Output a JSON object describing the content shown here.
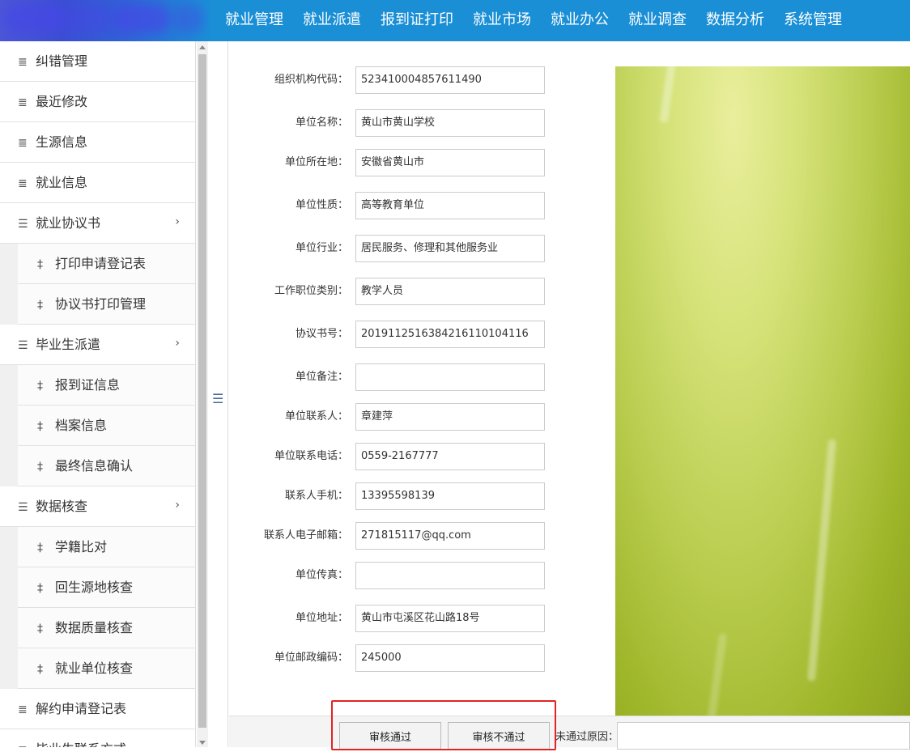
{
  "nav": {
    "items": [
      "就业管理",
      "就业派遣",
      "报到证打印",
      "就业市场",
      "就业办公",
      "就业调查",
      "数据分析",
      "系统管理"
    ]
  },
  "sidebar": {
    "items": [
      {
        "label": "纠错管理",
        "level": "top",
        "icon": "indent-icon"
      },
      {
        "label": "最近修改",
        "level": "top",
        "icon": "indent-icon"
      },
      {
        "label": "生源信息",
        "level": "top",
        "icon": "indent-icon"
      },
      {
        "label": "就业信息",
        "level": "top",
        "icon": "indent-icon"
      },
      {
        "label": "就业协议书",
        "level": "top",
        "icon": "list-icon",
        "expandable": true
      },
      {
        "label": "打印申请登记表",
        "level": "sub",
        "icon": "sign-icon"
      },
      {
        "label": "协议书打印管理",
        "level": "sub",
        "icon": "sign-icon"
      },
      {
        "label": "毕业生派遣",
        "level": "top",
        "icon": "list-icon",
        "expandable": true
      },
      {
        "label": "报到证信息",
        "level": "sub",
        "icon": "sign-icon"
      },
      {
        "label": "档案信息",
        "level": "sub",
        "icon": "sign-icon"
      },
      {
        "label": "最终信息确认",
        "level": "sub",
        "icon": "sign-icon"
      },
      {
        "label": "数据核查",
        "level": "top",
        "icon": "list-icon",
        "expandable": true
      },
      {
        "label": "学籍比对",
        "level": "sub",
        "icon": "sign-icon"
      },
      {
        "label": "回生源地核查",
        "level": "sub",
        "icon": "sign-icon"
      },
      {
        "label": "数据质量核查",
        "level": "sub",
        "icon": "sign-icon"
      },
      {
        "label": "就业单位核查",
        "level": "sub",
        "icon": "sign-icon"
      },
      {
        "label": "解约申请登记表",
        "level": "top",
        "icon": "indent-icon"
      },
      {
        "label": "毕业生联系方式",
        "level": "top",
        "icon": "indent-icon"
      }
    ]
  },
  "form": {
    "fields": [
      {
        "label": "组织机构代码：",
        "value": "523410004857611490"
      },
      {
        "label": "单位名称：",
        "value": "黄山市黄山学校"
      },
      {
        "label": "单位所在地：",
        "value": "安徽省黄山市"
      },
      {
        "label": "单位性质：",
        "value": "高等教育单位"
      },
      {
        "label": "单位行业：",
        "value": "居民服务、修理和其他服务业"
      },
      {
        "label": "工作职位类别：",
        "value": "教学人员"
      },
      {
        "label": "协议书号：",
        "value": "20191125163842161101041​16"
      },
      {
        "label": "单位备注：",
        "value": ""
      },
      {
        "label": "单位联系人：",
        "value": "章建萍"
      },
      {
        "label": "单位联系电话：",
        "value": "0559-2167777"
      },
      {
        "label": "联系人手机：",
        "value": "13395598139"
      },
      {
        "label": "联系人电子邮箱：",
        "value": "271815117@qq.com"
      },
      {
        "label": "单位传真：",
        "value": ""
      },
      {
        "label": "单位地址：",
        "value": "黄山市屯溪区花山路18号"
      },
      {
        "label": "单位邮政编码：",
        "value": "245000"
      }
    ]
  },
  "actions": {
    "approve_label": "审核通过",
    "reject_label": "审核不通过",
    "reject_reason_label": "未通过原因："
  },
  "colors": {
    "topbar": "#1a8fd6",
    "highlight": "#e02424"
  }
}
